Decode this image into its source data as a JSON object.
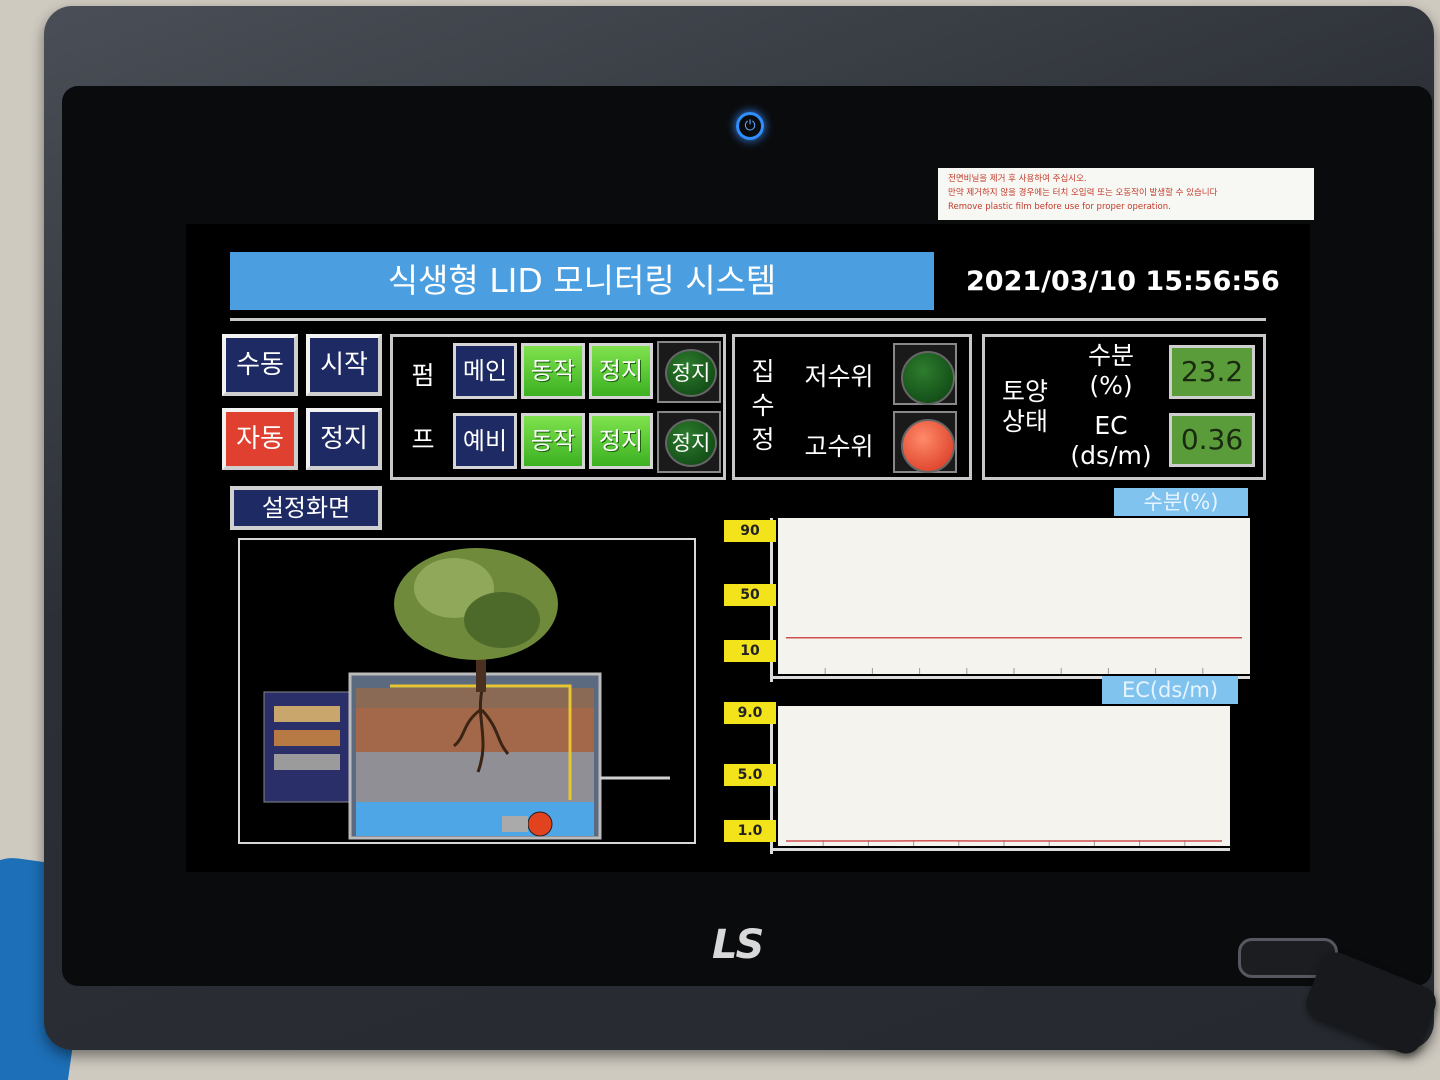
{
  "header": {
    "title": "식생형 LID 모니터링 시스템",
    "datetime": "2021/03/10 15:56:56"
  },
  "modes": {
    "manual": "수동",
    "start": "시작",
    "auto": "자동",
    "stop": "정지",
    "settings": "설정화면"
  },
  "pump": {
    "label_top": "펌",
    "label_bottom": "프",
    "rows": [
      {
        "name": "메인",
        "run": "동작",
        "stop": "정지",
        "status": "정지"
      },
      {
        "name": "예비",
        "run": "동작",
        "stop": "정지",
        "status": "정지"
      }
    ]
  },
  "sump": {
    "label": [
      "집",
      "수",
      "정"
    ],
    "low_level": "저수위",
    "high_level": "고수위",
    "low_level_lamp": "green",
    "high_level_lamp": "red"
  },
  "soil": {
    "label_line1": "토양",
    "label_line2": "상태",
    "moisture_label_1": "수분",
    "moisture_label_2": "(%)",
    "moisture_value": "23.2",
    "ec_label_1": "EC",
    "ec_label_2": "(ds/m)",
    "ec_value": "0.36"
  },
  "charts": {
    "moisture_tag": "수분(%)",
    "ec_tag": "EC(ds/m)"
  },
  "chart_data": [
    {
      "type": "line",
      "title": "수분(%)",
      "yticks": [
        "90",
        "50",
        "10"
      ],
      "ylim": [
        0,
        100
      ],
      "series": [
        {
          "values": [
            23.2,
            23.2,
            23.2,
            23.2,
            23.2,
            23.2,
            23.2,
            23.2,
            23.2,
            23.2
          ]
        }
      ],
      "color": "#d05050"
    },
    {
      "type": "line",
      "title": "EC(ds/m)",
      "yticks": [
        "9.0",
        "5.0",
        "1.0"
      ],
      "ylim": [
        0,
        10
      ],
      "series": [
        {
          "values": [
            0.36,
            0.36,
            0.36,
            0.37,
            0.36,
            0.36,
            0.36,
            0.36,
            0.36,
            0.36
          ]
        }
      ],
      "color": "#d05050"
    }
  ],
  "bezel": {
    "warning_line1": "전면비닐을 제거 후 사용하여 주십시오.",
    "warning_line2": "만약 제거하지 않을 경우에는 터치 오입력 또는 오동작이 발생할 수 있습니다",
    "warning_line3": "Remove plastic film before use for proper operation.",
    "logo": "LS"
  }
}
